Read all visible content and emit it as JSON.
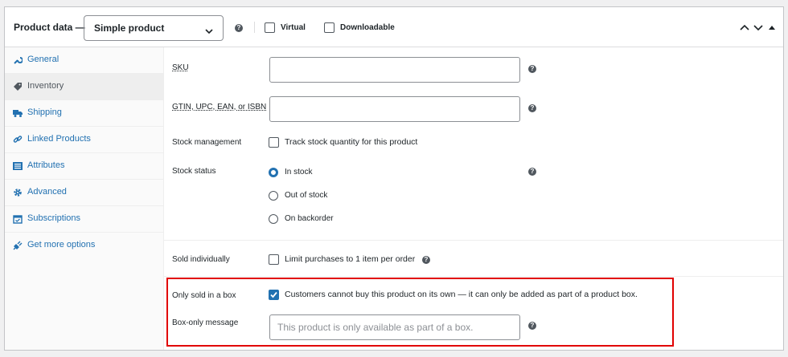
{
  "header": {
    "product_data_label": "Product data —",
    "product_type": "Simple product",
    "virtual_label": "Virtual",
    "downloadable_label": "Downloadable"
  },
  "sidebar": {
    "items": [
      {
        "label": "General",
        "icon": "wrench-icon"
      },
      {
        "label": "Inventory",
        "icon": "tag-icon",
        "active": true
      },
      {
        "label": "Shipping",
        "icon": "truck-icon"
      },
      {
        "label": "Linked Products",
        "icon": "link-icon"
      },
      {
        "label": "Attributes",
        "icon": "list-icon"
      },
      {
        "label": "Advanced",
        "icon": "gear-icon"
      },
      {
        "label": "Subscriptions",
        "icon": "calendar-icon"
      },
      {
        "label": "Get more options",
        "icon": "plugin-icon"
      }
    ]
  },
  "fields": {
    "sku": {
      "label": "SKU",
      "value": ""
    },
    "gtin": {
      "label": "GTIN, UPC, EAN, or ISBN",
      "value": ""
    },
    "stock_management": {
      "label": "Stock management",
      "checkbox_label": "Track stock quantity for this product",
      "checked": false
    },
    "stock_status": {
      "label": "Stock status",
      "options": [
        "In stock",
        "Out of stock",
        "On backorder"
      ],
      "selected": "In stock"
    },
    "sold_individually": {
      "label": "Sold individually",
      "checkbox_label": "Limit purchases to 1 item per order",
      "checked": false
    },
    "only_in_box": {
      "label": "Only sold in a box",
      "checkbox_label": "Customers cannot buy this product on its own — it can only be added as part of a product box.",
      "checked": true
    },
    "box_message": {
      "label": "Box-only message",
      "placeholder": "This product is only available as part of a box."
    }
  },
  "colors": {
    "accent": "#2271b1",
    "highlight": "#e10000"
  }
}
